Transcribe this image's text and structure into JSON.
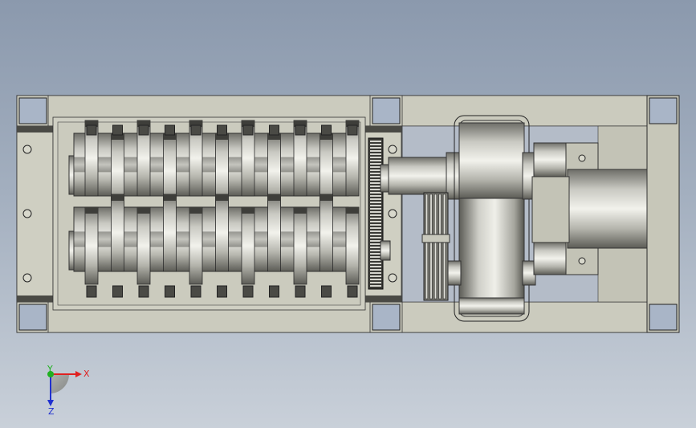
{
  "viewport": {
    "background_top": "#8b99ad",
    "background_bottom": "#c9d0d9"
  },
  "model": {
    "frame_color": "#c6c6b8",
    "frame_edge_color": "#2b2b2b",
    "shaft_count": 2,
    "blade_columns": 11,
    "components": [
      "frame",
      "shredder-blades",
      "gear",
      "coupling",
      "pulley",
      "gearbox",
      "motor"
    ]
  },
  "triad": {
    "x_label": "X",
    "y_label": "Y",
    "z_label": "Z",
    "x_color": "#e02020",
    "y_color": "#20b020",
    "z_color": "#2030d0"
  }
}
